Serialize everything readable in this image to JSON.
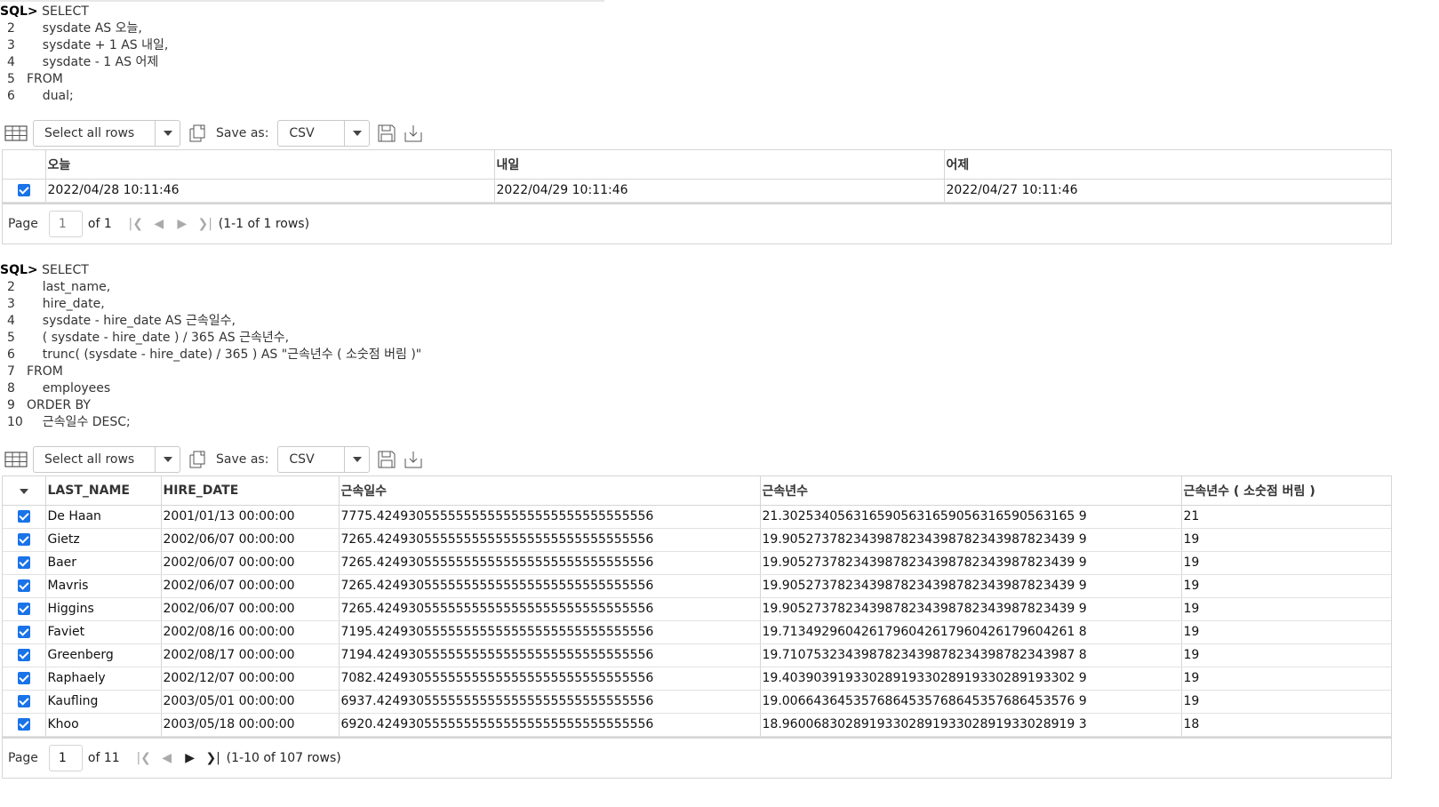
{
  "query1": {
    "prompt": "SQL>",
    "lines": [
      {
        "num": "",
        "text": " SELECT"
      },
      {
        "num": "2",
        "text": "    sysdate AS 오늘,"
      },
      {
        "num": "3",
        "text": "    sysdate + 1 AS 내일,"
      },
      {
        "num": "4",
        "text": "    sysdate - 1 AS 어제"
      },
      {
        "num": "5",
        "text": "FROM"
      },
      {
        "num": "6",
        "text": "    dual;"
      }
    ]
  },
  "toolbar": {
    "select_rows_label": "Select all rows",
    "save_as_label": "Save as:",
    "format_value": "CSV"
  },
  "result1": {
    "columns": [
      "오늘",
      "내일",
      "어제"
    ],
    "rows": [
      [
        "2022/04/28 10:11:46",
        "2022/04/29 10:11:46",
        "2022/04/27 10:11:46"
      ]
    ],
    "pager": {
      "page_label": "Page",
      "page": "1",
      "of_label": "of 1",
      "rows_label": "(1-1 of 1 rows)"
    }
  },
  "query2": {
    "prompt": "SQL>",
    "lines": [
      {
        "num": "",
        "text": " SELECT"
      },
      {
        "num": "2",
        "text": "    last_name,"
      },
      {
        "num": "3",
        "text": "    hire_date,"
      },
      {
        "num": "4",
        "text": "    sysdate - hire_date AS 근속일수,"
      },
      {
        "num": "5",
        "text": "    ( sysdate - hire_date ) / 365 AS 근속년수,"
      },
      {
        "num": "6",
        "text": "    trunc( (sysdate - hire_date) / 365 ) AS \"근속년수 ( 소숫점 버림 )\""
      },
      {
        "num": "7",
        "text": "FROM"
      },
      {
        "num": "8",
        "text": "    employees"
      },
      {
        "num": "9",
        "text": "ORDER BY"
      },
      {
        "num": "10",
        "text": "    근속일수 DESC;"
      }
    ]
  },
  "result2": {
    "columns": [
      "LAST_NAME",
      "HIRE_DATE",
      "근속일수",
      "근속년수",
      "근속년수 ( 소숫점 버림 )"
    ],
    "rows": [
      [
        "De Haan",
        "2001/01/13 00:00:00",
        "7775.42493055555555555555555555555555556",
        "21.3025340563165905631659056316590563165 9",
        "21"
      ],
      [
        "Gietz",
        "2002/06/07 00:00:00",
        "7265.42493055555555555555555555555555556",
        "19.9052737823439878234398782343987823439 9",
        "19"
      ],
      [
        "Baer",
        "2002/06/07 00:00:00",
        "7265.42493055555555555555555555555555556",
        "19.9052737823439878234398782343987823439 9",
        "19"
      ],
      [
        "Mavris",
        "2002/06/07 00:00:00",
        "7265.42493055555555555555555555555555556",
        "19.9052737823439878234398782343987823439 9",
        "19"
      ],
      [
        "Higgins",
        "2002/06/07 00:00:00",
        "7265.42493055555555555555555555555555556",
        "19.9052737823439878234398782343987823439 9",
        "19"
      ],
      [
        "Faviet",
        "2002/08/16 00:00:00",
        "7195.42493055555555555555555555555555556",
        "19.7134929604261796042617960426179604261 8",
        "19"
      ],
      [
        "Greenberg",
        "2002/08/17 00:00:00",
        "7194.42493055555555555555555555555555556",
        "19.7107532343987823439878234398782343987 8",
        "19"
      ],
      [
        "Raphaely",
        "2002/12/07 00:00:00",
        "7082.42493055555555555555555555555555556",
        "19.4039039193302891933028919330289193302 9",
        "19"
      ],
      [
        "Kaufling",
        "2003/05/01 00:00:00",
        "6937.42493055555555555555555555555555556",
        "19.0066436453576864535768645357686453576 9",
        "19"
      ],
      [
        "Khoo",
        "2003/05/18 00:00:00",
        "6920.42493055555555555555555555555555556",
        "18.9600683028919330289193302891933028919 3",
        "18"
      ]
    ],
    "pager": {
      "page_label": "Page",
      "page": "1",
      "of_label": "of 11",
      "rows_label": "(1-10 of 107 rows)"
    }
  },
  "icons": [
    "grid-view-icon",
    "copy-icon",
    "save-icon",
    "download-icon",
    "first-page-icon",
    "prev-page-icon",
    "next-page-icon",
    "last-page-icon"
  ],
  "colors": {
    "checkbox": "#1a73e8",
    "border": "#d5d5d5"
  }
}
